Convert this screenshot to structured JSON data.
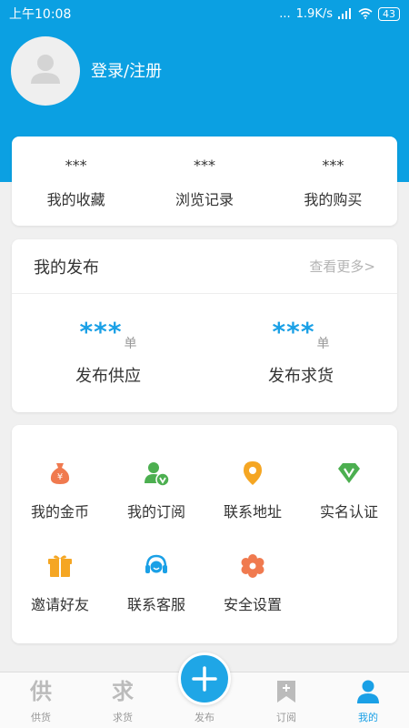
{
  "status": {
    "time": "上午10:08",
    "dots": "...",
    "speed": "1.9K/s",
    "battery": "43"
  },
  "profile": {
    "login_label": "登录/注册"
  },
  "stats": [
    {
      "value": "***",
      "label": "我的收藏"
    },
    {
      "value": "***",
      "label": "浏览记录"
    },
    {
      "value": "***",
      "label": "我的购买"
    }
  ],
  "publish": {
    "title": "我的发布",
    "more": "查看更多>",
    "items": [
      {
        "value": "***",
        "unit": "单",
        "label": "发布供应"
      },
      {
        "value": "***",
        "unit": "单",
        "label": "发布求货"
      }
    ]
  },
  "services": [
    {
      "icon": "money-bag-icon",
      "label": "我的金币",
      "color": "#f07a4f"
    },
    {
      "icon": "user-subscription-icon",
      "label": "我的订阅",
      "color": "#4caf50"
    },
    {
      "icon": "location-pin-icon",
      "label": "联系地址",
      "color": "#f5a623"
    },
    {
      "icon": "verified-v-icon",
      "label": "实名认证",
      "color": "#4caf50"
    },
    {
      "icon": "gift-icon",
      "label": "邀请好友",
      "color": "#f5a623"
    },
    {
      "icon": "headset-icon",
      "label": "联系客服",
      "color": "#1aa0e6"
    },
    {
      "icon": "settings-flower-icon",
      "label": "安全设置",
      "color": "#f07a4f"
    }
  ],
  "tabs": [
    {
      "icon": "supply-icon",
      "glyph": "供",
      "label": "供货",
      "active": false
    },
    {
      "icon": "demand-icon",
      "glyph": "求",
      "label": "求货",
      "active": false
    },
    {
      "icon": "publish-plus-icon",
      "label": "发布",
      "active": false
    },
    {
      "icon": "subscribe-bookmark-icon",
      "label": "订阅",
      "active": false
    },
    {
      "icon": "profile-user-icon",
      "label": "我的",
      "active": true
    }
  ],
  "colors": {
    "brand": "#0ba0e2",
    "accent": "#1aa0e6"
  }
}
